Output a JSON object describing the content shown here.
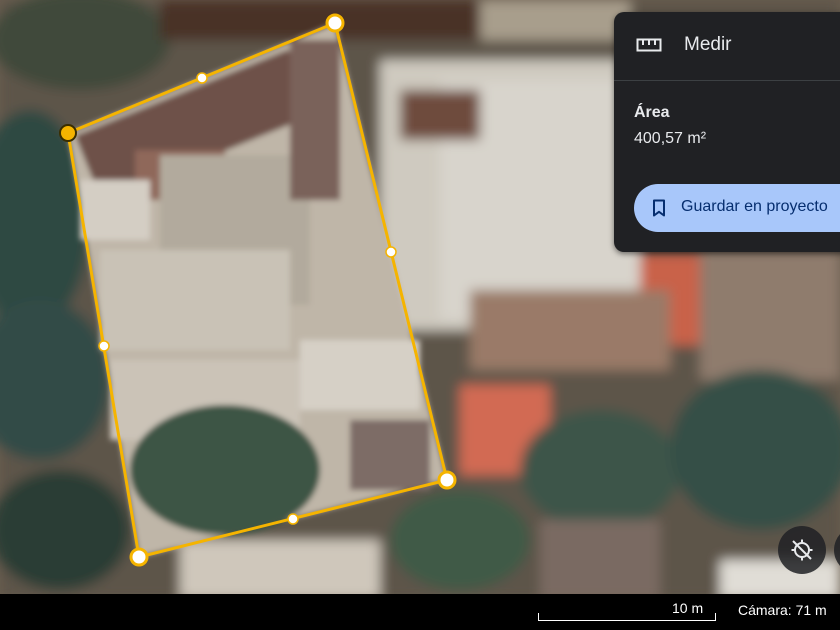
{
  "measure_panel": {
    "title": "Medir",
    "title_icon": "ruler-icon",
    "area_label": "Área",
    "area_value": "400,57 m²",
    "save_label": "Guardar en proyecto",
    "save_icon": "bookmark-icon"
  },
  "map_controls": {
    "compass_icon": "compass-off-icon"
  },
  "status_bar": {
    "scale_label": "10 m",
    "camera_label": "Cámara: 71 m"
  },
  "colors": {
    "measure_line": "#f5b400",
    "vertex_fill": "#ffffff",
    "panel_bg": "#202124",
    "button_bg": "#a8c7fa",
    "button_text": "#062e6f"
  }
}
